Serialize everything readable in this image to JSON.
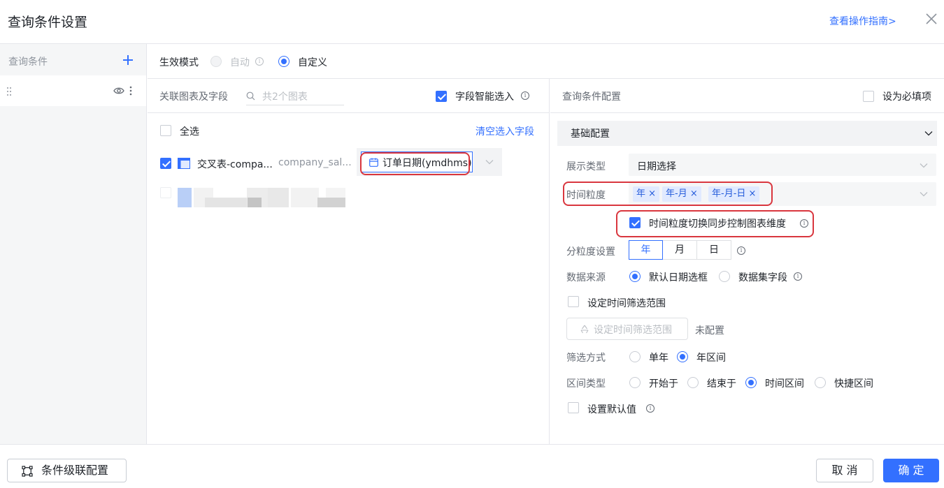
{
  "dialog": {
    "title": "查询条件设置",
    "guide_link": "查看操作指南>"
  },
  "sidebar": {
    "title": "查询条件"
  },
  "mode": {
    "label": "生效模式",
    "options": [
      {
        "label": "自动",
        "selected": false,
        "disabled": true
      },
      {
        "label": "自定义",
        "selected": true,
        "disabled": false
      }
    ]
  },
  "charts_panel": {
    "title": "关联图表及字段",
    "search_placeholder": "共2个图表",
    "smart_select_label": "字段智能选入",
    "smart_select_checked": true,
    "select_all_label": "全选",
    "clear_link": "清空选入字段",
    "rows": [
      {
        "checked": true,
        "chart_name": "交叉表-compa...",
        "dataset_name": "company_sal...",
        "field": "订单日期(ymdhms)"
      }
    ]
  },
  "config_panel": {
    "title": "查询条件配置",
    "required_label": "设为必填项",
    "section_title": "基础配置",
    "display_type": {
      "label": "展示类型",
      "value": "日期选择"
    },
    "granularity": {
      "label": "时间粒度",
      "tags": [
        "年",
        "年-月",
        "年-月-日"
      ]
    },
    "sync_control": {
      "label": "时间粒度切换同步控制图表维度",
      "checked": true
    },
    "sub_granularity": {
      "label": "分粒度设置",
      "options": [
        "年",
        "月",
        "日"
      ],
      "active_index": 0
    },
    "data_source": {
      "label": "数据来源",
      "options": [
        {
          "label": "默认日期选框",
          "selected": true
        },
        {
          "label": "数据集字段",
          "selected": false
        }
      ]
    },
    "time_range": {
      "label": "设定时间筛选范围",
      "checked": false,
      "button_label": "设定时间筛选范围",
      "status": "未配置"
    },
    "filter_mode": {
      "label": "筛选方式",
      "options": [
        {
          "label": "单年",
          "selected": false
        },
        {
          "label": "年区间",
          "selected": true
        }
      ]
    },
    "range_type": {
      "label": "区间类型",
      "options": [
        {
          "label": "开始于",
          "selected": false
        },
        {
          "label": "结束于",
          "selected": false
        },
        {
          "label": "时间区间",
          "selected": true
        },
        {
          "label": "快捷区间",
          "selected": false
        }
      ]
    },
    "default_value": {
      "label": "设置默认值",
      "checked": false
    }
  },
  "footer": {
    "cascade_button": "条件级联配置",
    "cancel_button": "取 消",
    "ok_button": "确 定"
  },
  "colors": {
    "primary": "#3370ff",
    "highlight_box": "#d9363e",
    "tag_bg": "#e1eaff"
  }
}
